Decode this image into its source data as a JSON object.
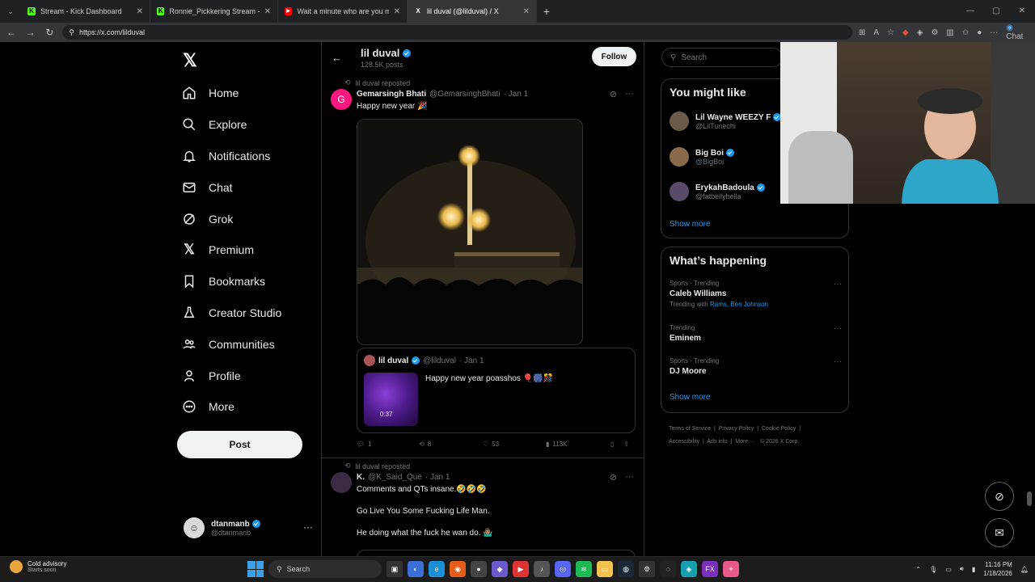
{
  "browser": {
    "tabs": [
      {
        "title": "Stream - Kick Dashboard",
        "fav_color": "#53fc18",
        "fav_char": "K"
      },
      {
        "title": "Ronnie_Pickkering Stream - Watch",
        "fav_color": "#53fc18",
        "fav_char": "K"
      },
      {
        "title": "Wait a minute who are you meme",
        "fav_color": "#ff0000",
        "fav_char": "▶"
      },
      {
        "title": "lil duval (@lilduval) / X",
        "fav_color": "#000000",
        "fav_char": "X"
      }
    ],
    "url": "https://x.com/lilduval",
    "chat_label": "Chat"
  },
  "nav": {
    "items": [
      {
        "label": "Home",
        "icon": "home-icon"
      },
      {
        "label": "Explore",
        "icon": "search-icon"
      },
      {
        "label": "Notifications",
        "icon": "bell-icon"
      },
      {
        "label": "Chat",
        "icon": "mail-icon"
      },
      {
        "label": "Grok",
        "icon": "grok-icon"
      },
      {
        "label": "Premium",
        "icon": "x-icon"
      },
      {
        "label": "Bookmarks",
        "icon": "bookmark-icon"
      },
      {
        "label": "Creator Studio",
        "icon": "flask-icon"
      },
      {
        "label": "Communities",
        "icon": "people-icon"
      },
      {
        "label": "Profile",
        "icon": "person-icon"
      },
      {
        "label": "More",
        "icon": "more-circle-icon"
      }
    ],
    "post_label": "Post",
    "account": {
      "name": "dtanmanb",
      "handle": "@dtanmanb"
    }
  },
  "profile": {
    "name": "lil duval",
    "posts": "128.5K posts",
    "follow_label": "Follow"
  },
  "tweets": [
    {
      "repost_label": "lil duval reposted",
      "avatar_char": "G",
      "avatar_color": "#f91880",
      "name": "Gemarsingh Bhati",
      "handle": "@GemarsinghBhati",
      "date": "· Jan 1",
      "text": "Happy new year 🎉",
      "quote": {
        "name": "lil duval",
        "handle": "@lilduval",
        "date": "· Jan 1",
        "text": "Happy new year poasshos 🎈🎆🎊",
        "duration": "0:37"
      },
      "stats": {
        "replies": "1",
        "reposts": "8",
        "likes": "53",
        "views": "113K"
      }
    },
    {
      "repost_label": "lil duval reposted",
      "name": "K.",
      "handle": "@K_Said_Que",
      "date": "· Jan 1",
      "lines": [
        "Comments and QTs insane.🤣🤣🤣",
        "Go Live You Some Fucking Life Man.",
        "He doing what the fuck he wan do. 🤷🏽‍♂️"
      ]
    }
  ],
  "right": {
    "search_placeholder": "Search",
    "you_might_like": {
      "title": "You might like",
      "items": [
        {
          "name": "Lil Wayne WEEZY F",
          "handle": "@LilTunechi",
          "color": "#6b5a4a"
        },
        {
          "name": "Big Boi",
          "handle": "@BigBoi",
          "color": "#8a6a4a"
        },
        {
          "name": "ErykahBadoula",
          "handle": "@fatbellybella",
          "color": "#5a4a6a"
        }
      ],
      "show_more": "Show more"
    },
    "happening": {
      "title": "What’s happening",
      "trends": [
        {
          "category": "Sports · Trending",
          "name": "Caleb Williams",
          "with_label": "Trending with",
          "with": "Rams, Ben Johnson"
        },
        {
          "category": "Trending",
          "name": "Eminem"
        },
        {
          "category": "Sports · Trending",
          "name": "DJ Moore"
        }
      ],
      "show_more": "Show more"
    },
    "footer": [
      "Terms of Service",
      "Privacy Policy",
      "Cookie Policy",
      "Accessibility",
      "Ads info",
      "More ···",
      "© 2026 X Corp."
    ]
  },
  "taskbar": {
    "weather_title": "Cold advisory",
    "weather_sub": "Starts soon",
    "search_label": "Search",
    "time": "11:16 PM",
    "date": "1/18/2026"
  }
}
